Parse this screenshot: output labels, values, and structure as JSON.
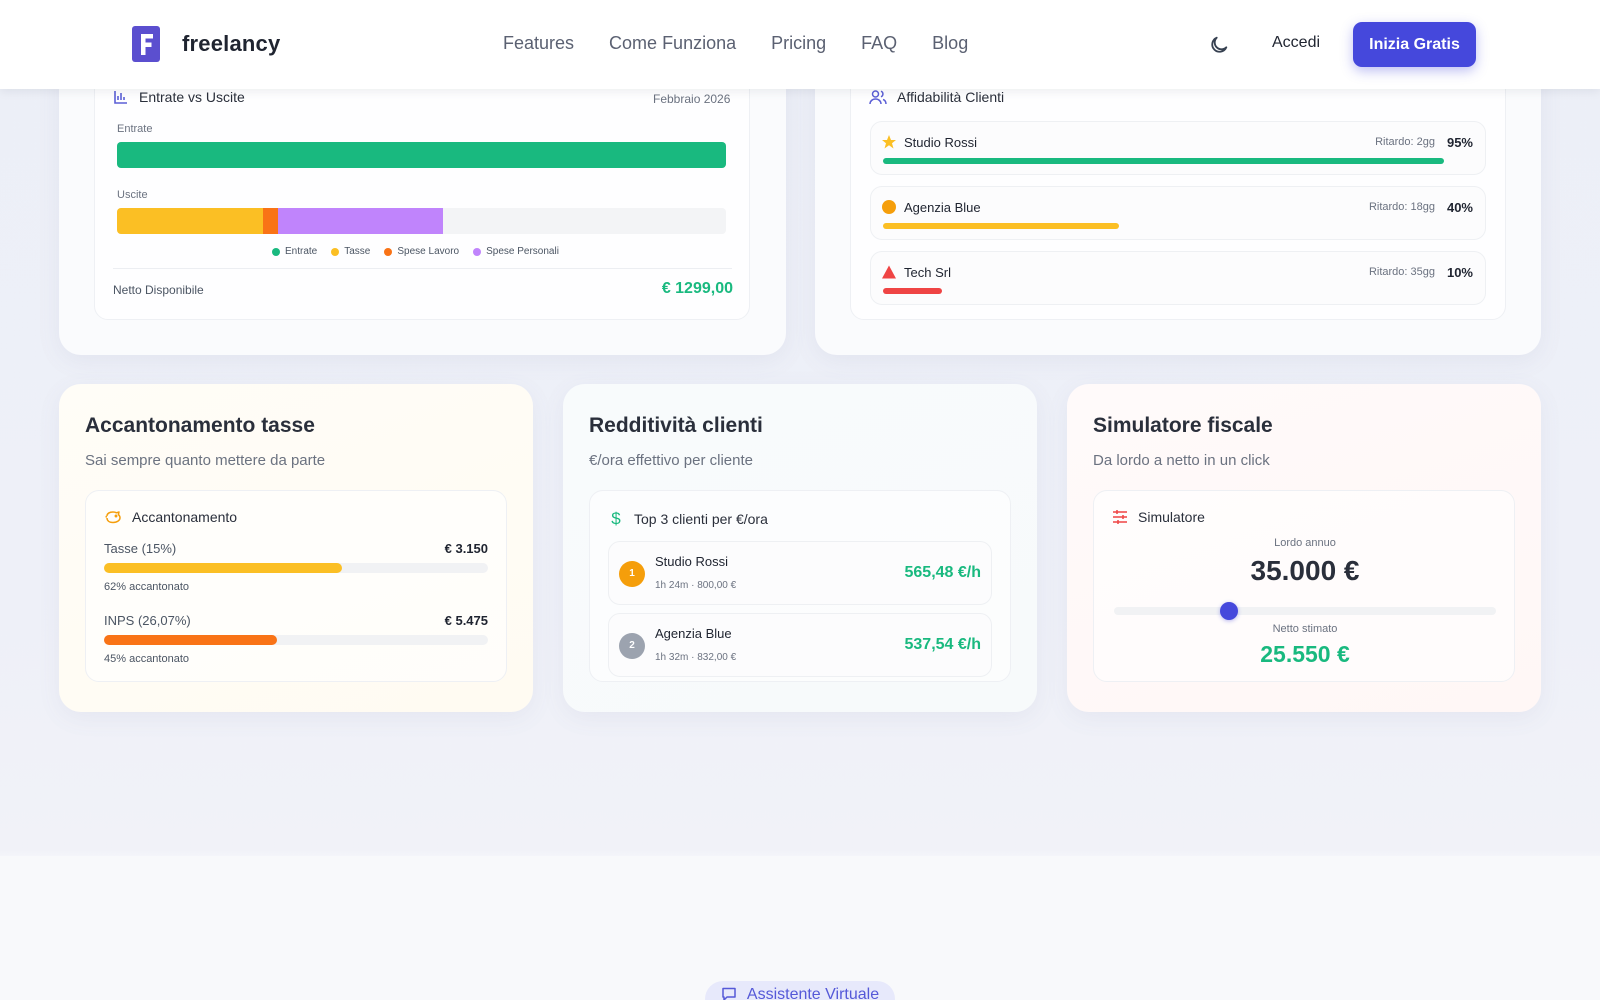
{
  "nav": {
    "brand": "freelancy",
    "menu": [
      "Features",
      "Come Funziona",
      "Pricing",
      "FAQ",
      "Blog"
    ],
    "login": "Accedi",
    "cta": "Inizia Gratis"
  },
  "cashflow": {
    "title": "Entrate vs Uscite",
    "date": "Febbraio 2026",
    "income_label": "Entrate",
    "expense_label": "Uscite",
    "legend": [
      "Entrate",
      "Tasse",
      "Spese Lavoro",
      "Spese Personali"
    ],
    "net_label": "Netto Disponibile",
    "net_value": "€ 1299,00",
    "colors": {
      "income": "#19b97f",
      "tax": "#fbbf24",
      "work": "#f97316",
      "personal": "#c084fc"
    },
    "income_fill": 1.0,
    "expense_fills": {
      "tax": 0.24,
      "work": 0.025,
      "personal": 0.27
    }
  },
  "clients": {
    "title": "Affidabilità Clienti",
    "rows": [
      {
        "name": "Studio Rossi",
        "delay": "Ritardo: 2gg",
        "pct": "95%",
        "icon": "star-icon",
        "color": "#19b97f",
        "fill": 0.95
      },
      {
        "name": "Agenzia Blue",
        "delay": "Ritardo: 18gg",
        "pct": "40%",
        "icon": "circle-icon",
        "color": "#fbbf24",
        "fill": 0.4
      },
      {
        "name": "Tech Srl",
        "delay": "Ritardo: 35gg",
        "pct": "10%",
        "icon": "warning-icon",
        "color": "#ef4444",
        "fill": 0.1
      }
    ]
  },
  "tax_card": {
    "title": "Accantonamento tasse",
    "subtitle": "Sai sempre quanto mettere da parte",
    "panel_title": "Accantonamento",
    "items": [
      {
        "label": "Tasse (15%)",
        "amount": "€ 3.150",
        "note": "62% accantonato",
        "fill": 0.62
      },
      {
        "label": "INPS (26,07%)",
        "amount": "€ 5.475",
        "note": "45% accantonato",
        "fill": 0.45
      }
    ]
  },
  "profit_card": {
    "title": "Redditività clienti",
    "subtitle": "€/ora effettivo per cliente",
    "panel_title": "Top 3 clienti per €/ora",
    "rows": [
      {
        "rank": "1",
        "name": "Studio Rossi",
        "meta": "1h 24m · 800,00 €",
        "rate": "565,48 €/h",
        "badge_color": "#f59e0b"
      },
      {
        "rank": "2",
        "name": "Agenzia Blue",
        "meta": "1h 32m · 832,00 €",
        "rate": "537,54 €/h",
        "badge_color": "#9ca3af"
      }
    ]
  },
  "sim_card": {
    "title": "Simulatore fiscale",
    "subtitle": "Da lordo a netto in un click",
    "panel_title": "Simulatore",
    "gross_label": "Lordo annuo",
    "gross_value": "35.000 €",
    "net_label": "Netto stimato",
    "net_value": "25.550 €",
    "slider_level": 0.3
  },
  "assistant": {
    "label": "Assistente Virtuale"
  }
}
